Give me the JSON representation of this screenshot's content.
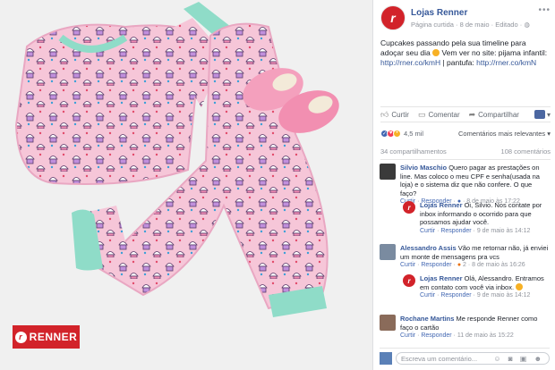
{
  "badge": {
    "brand": "RENNER",
    "logo_letter": "r"
  },
  "post": {
    "page_name": "Lojas Renner",
    "meta": "Página curtida · 8 de maio · Editado · ",
    "more": "•••",
    "text_1": "Cupcakes passando pela sua timeline para adoçar seu dia ",
    "text_2": " Vem ver no site: pijama infantil: ",
    "link_1": "http://rner.co/kmH",
    "text_3": " | pantufa: ",
    "link_2": "http://rner.co/kmN"
  },
  "actions": {
    "like": "Curtir",
    "comment": "Comentar",
    "share": "Compartilhar"
  },
  "reactions": {
    "count": "4,5 mil",
    "relevance": "Comentários mais relevantes ▾"
  },
  "stats": {
    "shares": "34 compartilhamentos",
    "comments": "108 comentários"
  },
  "comments": [
    {
      "name": "Silvio Maschio",
      "text": " Quero pagar as prestações on line. Mas coloco o meu CPF e senha(usada na loja) e o sistema diz que não confere. O que faço?",
      "like": "Curtir",
      "reply": "Responder",
      "time": " · 8 de maio às 17:22"
    },
    {
      "name": "Lojas Renner",
      "text": " Oi, Silvio. Nos contate por inbox informando o ocorrido para que possamos ajudar você.",
      "like": "Curtir",
      "reply": "Responder",
      "time": " · 9 de maio às 14:12"
    },
    {
      "name": "Alessandro Assis",
      "text": " Vão me retornar não, já enviei um monte de mensagens pra vcs",
      "like": "Curtir",
      "reply": "Responder",
      "reaction_count": "2",
      "time": " · 8 de maio às 16:26"
    },
    {
      "name": "Lojas Renner",
      "text": " Olá, Alessandro. Entramos em contato com você via inbox.",
      "like": "Curtir",
      "reply": "Responder",
      "time": " · 9 de maio às 14:12"
    },
    {
      "name": "Rochane Martins",
      "text": " Me responde Renner como faço o cartão",
      "like": "Curtir",
      "reply": "Responder",
      "time": " · 11 de maio às 15:22"
    }
  ],
  "input": {
    "placeholder": "Escreva um comentário...",
    "icons": "☺ ◙ ▣ ☻"
  }
}
